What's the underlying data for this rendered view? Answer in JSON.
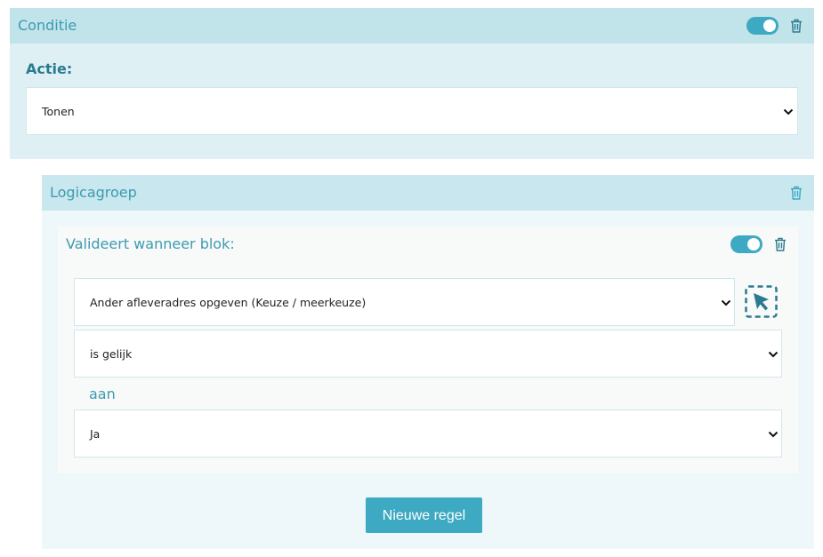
{
  "conditie": {
    "title": "Conditie",
    "toggle_on": true,
    "actie_label": "Actie:",
    "actie_value": "Tonen"
  },
  "logicagroep": {
    "title": "Logicagroep",
    "rule": {
      "title": "Valideert wanneer blok:",
      "toggle_on": true,
      "block_value": "Ander afleveradres opgeven (Keuze / meerkeuze)",
      "operator_value": "is gelijk",
      "aan_label": "aan",
      "compare_value": "Ja"
    },
    "new_rule_label": "Nieuwe regel"
  },
  "icons": {
    "toggle": "toggle-switch-icon",
    "delete": "trash-icon",
    "dropdown": "chevron-down-icon",
    "picker": "cursor-select-icon"
  },
  "colors": {
    "accent": "#3ea9c3",
    "header_bg": "#c1e3ea",
    "panel_bg": "#dff0f5",
    "title_text": "#3d9bb0"
  }
}
